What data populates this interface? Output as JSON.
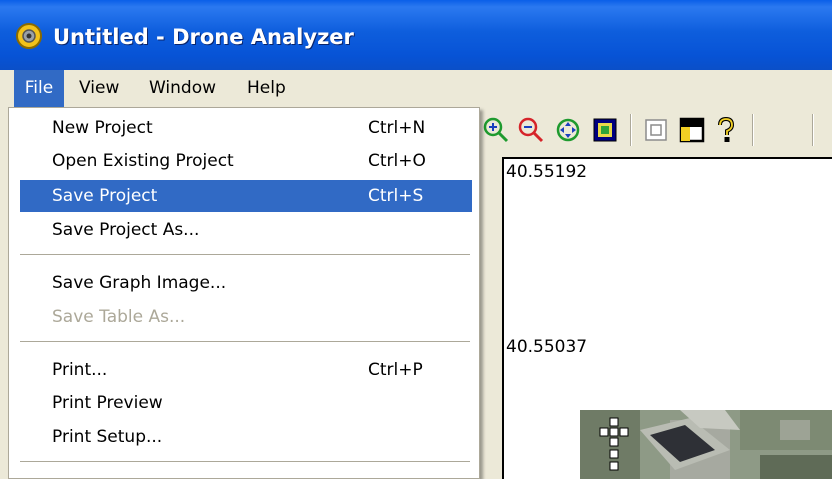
{
  "window": {
    "title": "Untitled - Drone Analyzer",
    "app_icon": "drone-analyzer-app-icon"
  },
  "menubar": [
    {
      "label": "File",
      "active": true
    },
    {
      "label": "View"
    },
    {
      "label": "Window"
    },
    {
      "label": "Help"
    }
  ],
  "file_menu": {
    "items": [
      {
        "label": "New Project",
        "shortcut": "Ctrl+N"
      },
      {
        "label": "Open Existing Project",
        "shortcut": "Ctrl+O"
      },
      {
        "label": "Save Project",
        "shortcut": "Ctrl+S",
        "highlighted": true
      },
      {
        "label": "Save Project As..."
      },
      {
        "label": "Save Graph Image..."
      },
      {
        "label": "Save Table As...",
        "disabled": true
      },
      {
        "label": "Print...",
        "shortcut": "Ctrl+P"
      },
      {
        "label": "Print Preview"
      },
      {
        "label": "Print Setup..."
      }
    ]
  },
  "toolbar": {
    "icons": [
      "zoom-in-icon",
      "zoom-out-icon",
      "zoom-extents-icon",
      "zoom-fit-icon",
      "frame-icon",
      "panel-icon",
      "help-icon"
    ]
  },
  "graph": {
    "y_labels": [
      "40.55192",
      "40.55037"
    ]
  },
  "colors": {
    "title_bar": "#0A5FE8",
    "menu_highlight": "#316AC5",
    "window_bg": "#ECE9D8",
    "disabled_text": "#ACA899"
  }
}
